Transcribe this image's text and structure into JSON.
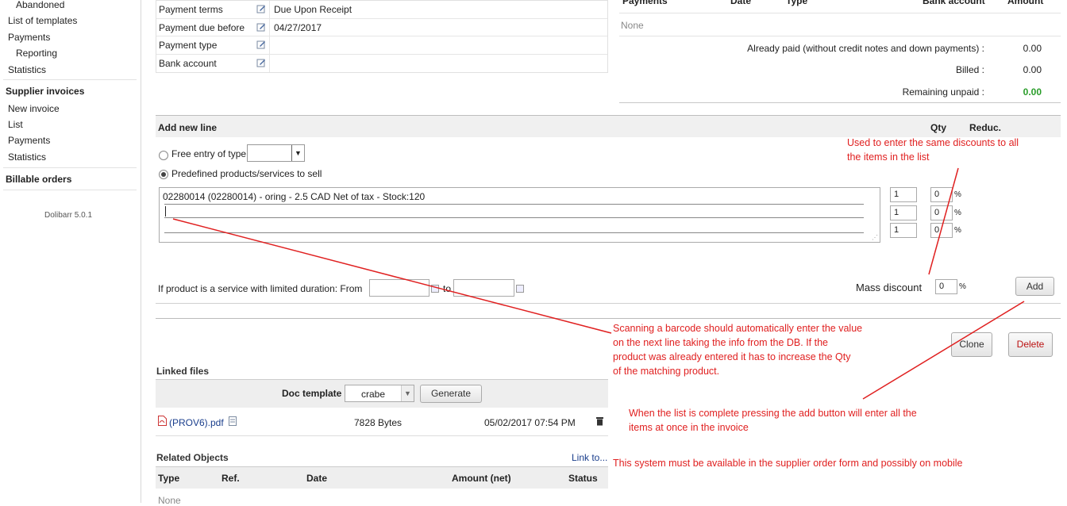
{
  "sidebar": {
    "items_top": [
      "Abandoned",
      "List of templates",
      "Payments",
      "Reporting",
      "Statistics"
    ],
    "supplier_heading": "Supplier invoices",
    "supplier_items": [
      "New invoice",
      "List",
      "Payments",
      "Statistics"
    ],
    "billable_heading": "Billable orders",
    "version": "Dolibarr 5.0.1"
  },
  "info": {
    "rows": [
      {
        "label": "Payment terms",
        "value": "Due Upon Receipt"
      },
      {
        "label": "Payment due before",
        "value": "04/27/2017"
      },
      {
        "label": "Payment type",
        "value": ""
      },
      {
        "label": "Bank account",
        "value": ""
      }
    ]
  },
  "payments": {
    "headers": [
      "Payments",
      "Date",
      "Type",
      "Bank account",
      "Amount"
    ],
    "none": "None",
    "already_paid_label": "Already paid (without credit notes and down payments) :",
    "already_paid_value": "0.00",
    "billed_label": "Billed :",
    "billed_value": "0.00",
    "remaining_label": "Remaining unpaid :",
    "remaining_value": "0.00",
    "remaining_color": "#2a9d2a"
  },
  "add_line": {
    "title": "Add new line",
    "qty_header": "Qty",
    "reduc_header": "Reduc.",
    "free_entry_label": "Free entry of type",
    "predefined_label": "Predefined products/services to sell",
    "product_line": "02280014 (02280014) - oring - 2.5 CAD Net of tax - Stock:120",
    "qty_values": [
      "1",
      "1",
      "1"
    ],
    "reduc_values": [
      "0",
      "0",
      "0"
    ],
    "pct": "%",
    "duration_label": "If product is a service with limited duration: From",
    "to_label": "to",
    "mass_discount_label": "Mass discount",
    "mass_discount_value": "0",
    "add_button": "Add"
  },
  "actions": {
    "clone": "Clone",
    "delete": "Delete"
  },
  "linked_files": {
    "title": "Linked files",
    "doc_template_label": "Doc template",
    "template_value": "crabe",
    "generate_button": "Generate",
    "file_name": "(PROV6).pdf",
    "file_size": "7828 Bytes",
    "file_date": "05/02/2017 07:54 PM"
  },
  "related": {
    "title": "Related Objects",
    "link_to": "Link to...",
    "headers": [
      "Type",
      "Ref.",
      "Date",
      "Amount (net)",
      "Status"
    ],
    "none": "None"
  },
  "annotations": {
    "discount_note": [
      "Used to enter the same discounts to all",
      "the items in the list"
    ],
    "barcode_note": [
      "Scanning a barcode should automatically enter the value",
      "on the next line taking the info from the DB. If the",
      "product was already entered it has to increase the Qty",
      "of the matching product."
    ],
    "add_note": [
      "When the list is complete pressing the add button will enter all the",
      "items at once in the invoice"
    ],
    "system_note": "This system must be available in the supplier order form and possibly on mobile",
    "color": "#e02020"
  }
}
